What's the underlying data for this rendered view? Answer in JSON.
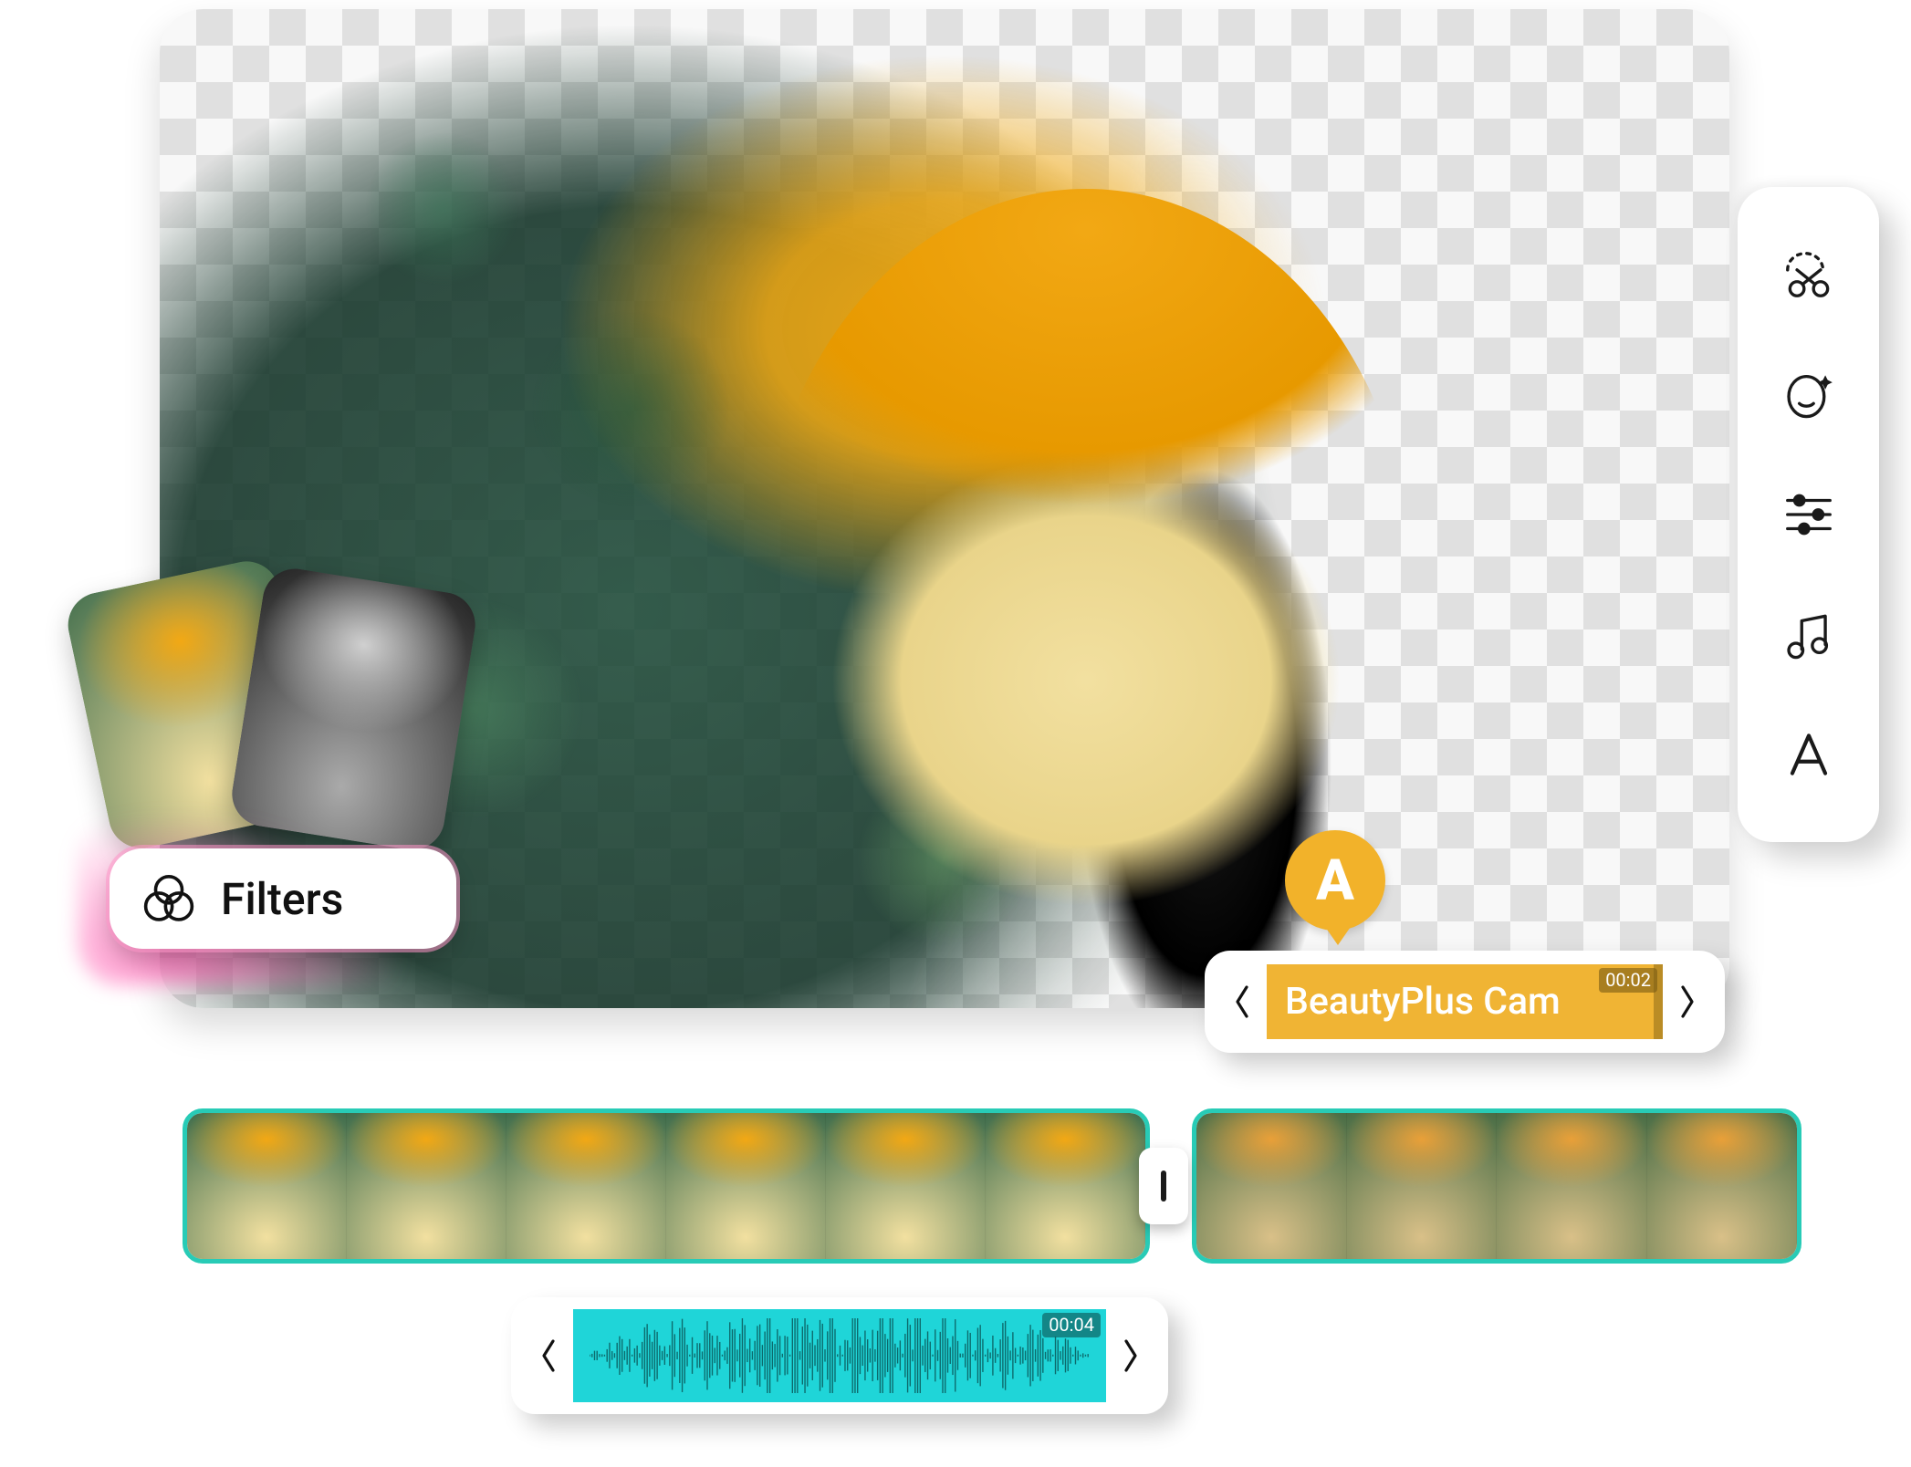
{
  "toolbar": {
    "tools": [
      {
        "name": "cutout-tool-icon"
      },
      {
        "name": "beautify-face-tool-icon"
      },
      {
        "name": "adjust-sliders-tool-icon"
      },
      {
        "name": "music-tool-icon"
      },
      {
        "name": "text-tool-icon"
      }
    ]
  },
  "filters_card": {
    "label": "Filters"
  },
  "text_clip": {
    "badge_letter": "A",
    "title": "BeautyPlus Cam",
    "time": "00:02"
  },
  "timeline": {
    "clip_a_frame_count": 6,
    "clip_b_frame_count": 4
  },
  "audio_clip": {
    "time": "00:04"
  },
  "colors": {
    "accent_orange": "#f2b22a",
    "accent_teal": "#28cbb6",
    "audio_cyan": "#1fd5d8",
    "filters_glow_pink": "#ff7ab8"
  }
}
